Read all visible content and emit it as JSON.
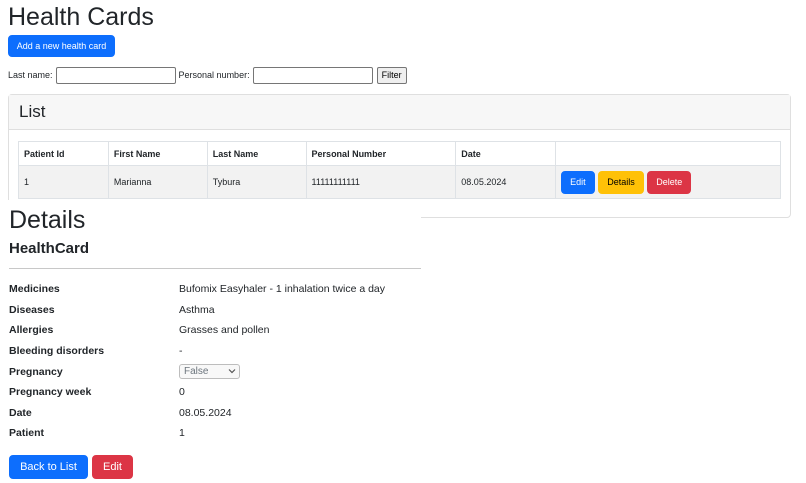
{
  "page": {
    "title": "Health Cards",
    "add_button": "Add a new health card"
  },
  "filter": {
    "last_name_label": "Last name:",
    "personal_number_label": "Personal number:",
    "last_name_value": "",
    "personal_number_value": "",
    "button_label": "Filter"
  },
  "list": {
    "header": "List",
    "columns": [
      "Patient Id",
      "First Name",
      "Last Name",
      "Personal Number",
      "Date",
      ""
    ],
    "rows": [
      {
        "patient_id": "1",
        "first_name": "Marianna",
        "last_name": "Tybura",
        "personal_number": "11111111111",
        "date": "08.05.2024",
        "actions": {
          "edit": "Edit",
          "details": "Details",
          "delete": "Delete"
        }
      }
    ]
  },
  "details": {
    "title": "Details",
    "subtitle": "HealthCard",
    "fields": [
      {
        "label": "Medicines",
        "value": "Bufomix Easyhaler - 1 inhalation twice a day"
      },
      {
        "label": "Diseases",
        "value": "Asthma"
      },
      {
        "label": "Allergies",
        "value": "Grasses and pollen"
      },
      {
        "label": "Bleeding disorders",
        "value": "-"
      },
      {
        "label": "Pregnancy",
        "value": "False"
      },
      {
        "label": "Pregnancy week",
        "value": "0"
      },
      {
        "label": "Date",
        "value": "08.05.2024"
      },
      {
        "label": "Patient",
        "value": "1"
      }
    ],
    "back_button": "Back to List",
    "edit_button": "Edit"
  },
  "colors": {
    "primary": "#0d6efd",
    "warning": "#ffc107",
    "danger": "#dc3545"
  },
  "icons": {
    "select_chevron": "chevron-down-icon"
  }
}
